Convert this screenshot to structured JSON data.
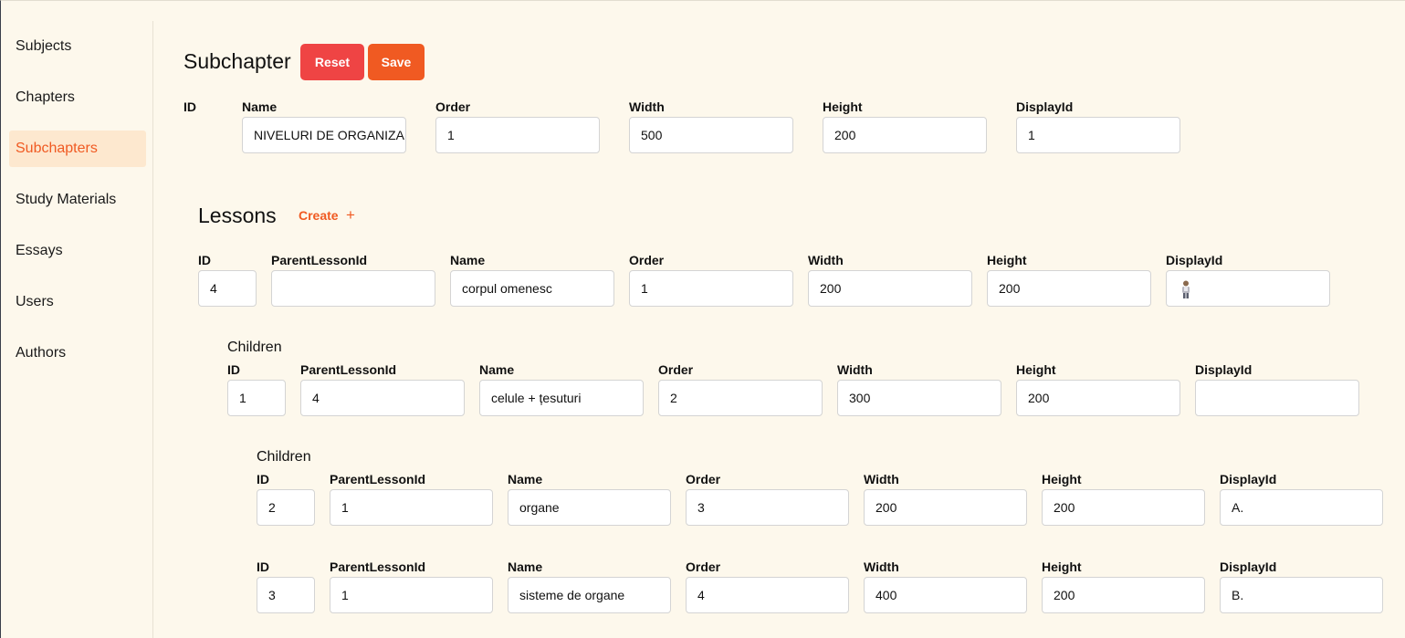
{
  "sidebar": {
    "items": [
      {
        "label": "Subjects"
      },
      {
        "label": "Chapters"
      },
      {
        "label": "Subchapters"
      },
      {
        "label": "Study Materials"
      },
      {
        "label": "Essays"
      },
      {
        "label": "Users"
      },
      {
        "label": "Authors"
      }
    ],
    "active": "Subchapters"
  },
  "subchapter": {
    "title": "Subchapter",
    "reset_label": "Reset",
    "save_label": "Save",
    "labels": {
      "id": "ID",
      "name": "Name",
      "order": "Order",
      "width": "Width",
      "height": "Height",
      "display_id": "DisplayId"
    },
    "values": {
      "id": "",
      "name": "NIVELURI DE ORGANIZARE",
      "order": "1",
      "width": "500",
      "height": "200",
      "display_id": "1"
    }
  },
  "lessons": {
    "title": "Lessons",
    "create_label": "Create",
    "create_icon": "plus-icon",
    "labels": {
      "id": "ID",
      "parent": "ParentLessonId",
      "name": "Name",
      "order": "Order",
      "width": "Width",
      "height": "Height",
      "display_id": "DisplayId"
    },
    "children_label": "Children",
    "lesson": {
      "id": "4",
      "parent": "",
      "name": "corpul omenesc",
      "order": "1",
      "width": "200",
      "height": "200",
      "display_id": "",
      "display_icon": "person-icon"
    },
    "child": {
      "id": "1",
      "parent": "4",
      "name": "celule + țesuturi",
      "order": "2",
      "width": "300",
      "height": "200",
      "display_id": ""
    },
    "grandchildren": [
      {
        "id": "2",
        "parent": "1",
        "name": "organe",
        "order": "3",
        "width": "200",
        "height": "200",
        "display_id": "A."
      },
      {
        "id": "3",
        "parent": "1",
        "name": "sisteme de organe",
        "order": "4",
        "width": "400",
        "height": "200",
        "display_id": "B."
      }
    ]
  },
  "colors": {
    "accent": "#f05a22",
    "reset": "#ef4444",
    "background": "#fdf8ec",
    "active_bg": "#fde8cf"
  }
}
